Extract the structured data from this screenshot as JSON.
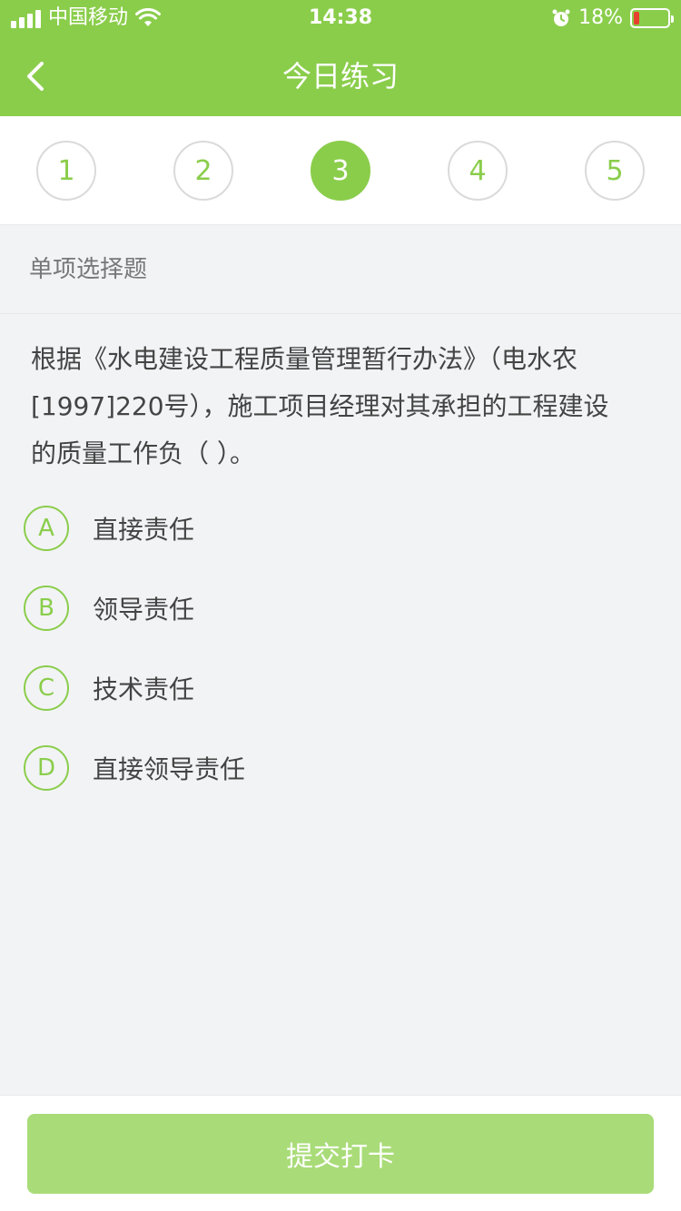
{
  "status_bar": {
    "carrier": "中国移动",
    "time": "14:38",
    "battery": "18%",
    "battery_level": 0.18,
    "icons": [
      "signal-icon",
      "wifi-icon",
      "alarm-icon",
      "battery-icon"
    ]
  },
  "nav": {
    "title": "今日练习",
    "back_icon": "chevron-left-icon"
  },
  "question_numbers": [
    "1",
    "2",
    "3",
    "4",
    "5"
  ],
  "current_question": "3",
  "question_type": "单项选择题",
  "question": {
    "line1": "根据《水电建设工程质量管理暂行办法》（电水农",
    "line2": "[1997]220号），施工项目经理对其承担的工程建设",
    "line3": "的质量工作负（    ）。"
  },
  "options": [
    {
      "letter": "A",
      "text": "直接责任"
    },
    {
      "letter": "B",
      "text": "领导责任"
    },
    {
      "letter": "C",
      "text": "技术责任"
    },
    {
      "letter": "D",
      "text": "直接领导责任"
    }
  ],
  "submit_label": "提交打卡",
  "colors": {
    "primary": "#8acd4b",
    "button_disabled": "#a9dc78",
    "background": "#f2f3f5"
  }
}
